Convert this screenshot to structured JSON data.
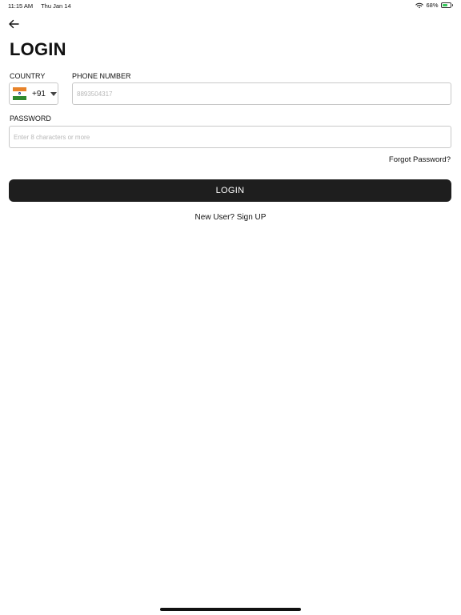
{
  "status_bar": {
    "time": "11:15 AM",
    "date": "Thu Jan 14",
    "battery_percent": "68%",
    "battery_level": 0.68,
    "wifi_icon": "wifi-icon",
    "battery_icon": "battery-icon",
    "battery_color": "#34c759"
  },
  "header": {
    "back_icon": "arrow-left-icon",
    "title": "LOGIN"
  },
  "form": {
    "country_label": "COUNTRY",
    "country_flag_icon": "india-flag-icon",
    "country_dial_code": "+91",
    "phone_label": "PHONE NUMBER",
    "phone_placeholder": "8893504317",
    "password_label": "PASSWORD",
    "password_placeholder": "Enter 8 characters or more",
    "forgot_password": "Forgot Password?",
    "login_button": "LOGIN",
    "signup_link": "New User? Sign UP"
  },
  "colors": {
    "primary_button": "#1e1e1e",
    "input_border": "#c8c8c8",
    "placeholder": "#b8b8b8"
  }
}
